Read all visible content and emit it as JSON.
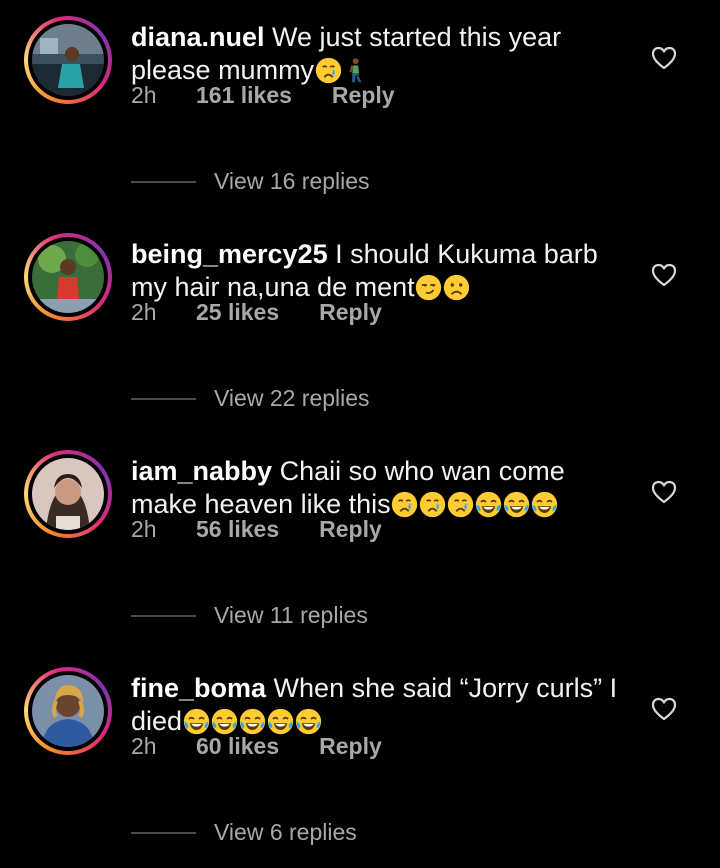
{
  "comments": [
    {
      "username": "diana.nuel",
      "text": "We just started this year please mummy",
      "emojis": [
        "crying-face",
        "person-kneeling"
      ],
      "time": "2h",
      "likes": "161 likes",
      "reply": "Reply",
      "view_replies": "View 16 replies"
    },
    {
      "username": "being_mercy25",
      "text": "I should Kukuma barb my hair na,una de ment",
      "emojis": [
        "smirking-face",
        "frowning-face"
      ],
      "time": "2h",
      "likes": "25 likes",
      "reply": "Reply",
      "view_replies": "View 22 replies"
    },
    {
      "username": "iam_nabby",
      "text": "Chaii so who wan come make heaven like this",
      "emojis": [
        "crying-face",
        "crying-face",
        "crying-face",
        "tears-of-joy",
        "tears-of-joy",
        "tears-of-joy"
      ],
      "time": "2h",
      "likes": "56 likes",
      "reply": "Reply",
      "view_replies": "View 11 replies"
    },
    {
      "username": "fine_boma",
      "text": "When she said “Jorry curls” I died",
      "emojis": [
        "tears-of-joy",
        "tears-of-joy",
        "tears-of-joy",
        "tears-of-joy",
        "tears-of-joy"
      ],
      "time": "2h",
      "likes": "60 likes",
      "reply": "Reply",
      "view_replies": "View 6 replies"
    }
  ],
  "colors": {
    "background": "#000000",
    "text": "#ffffff",
    "secondary_text": "#a8a8a8",
    "ring_start": "#f58529",
    "ring_end": "#dd2a7b"
  }
}
